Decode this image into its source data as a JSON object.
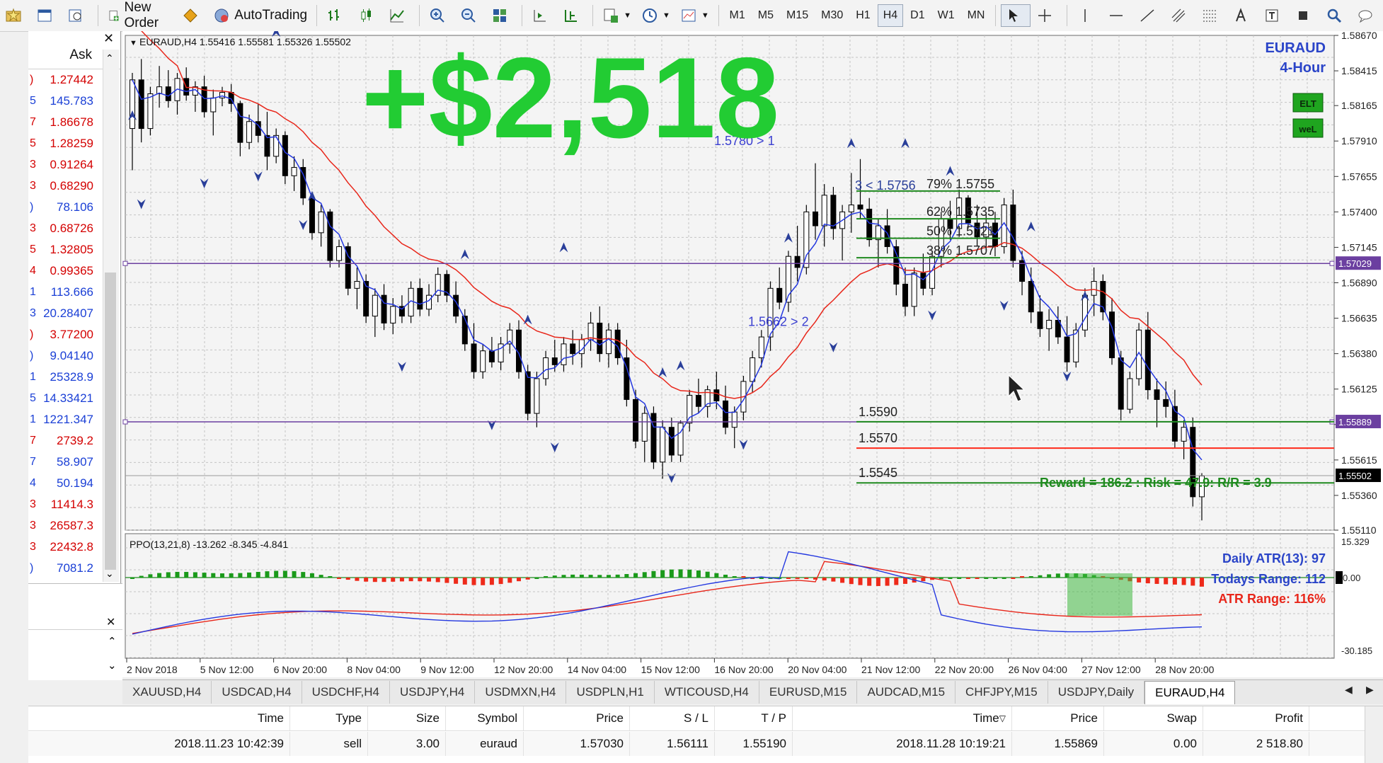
{
  "toolbar": {
    "new_order": "New Order",
    "autotrading": "AutoTrading",
    "timeframes": [
      "M1",
      "M5",
      "M15",
      "M30",
      "H1",
      "H4",
      "D1",
      "W1",
      "MN"
    ],
    "active_timeframe": "H4"
  },
  "market_watch": {
    "ask_header": "Ask",
    "rows": [
      {
        "stub": ")",
        "value": "1.27442",
        "color": "#d40000"
      },
      {
        "stub": "5",
        "value": "145.783",
        "color": "#1a3fd6"
      },
      {
        "stub": "7",
        "value": "1.86678",
        "color": "#d40000"
      },
      {
        "stub": "5",
        "value": "1.28259",
        "color": "#d40000"
      },
      {
        "stub": "3",
        "value": "0.91264",
        "color": "#d40000"
      },
      {
        "stub": "3",
        "value": "0.68290",
        "color": "#d40000"
      },
      {
        "stub": ")",
        "value": "78.106",
        "color": "#1a3fd6"
      },
      {
        "stub": "3",
        "value": "0.68726",
        "color": "#d40000"
      },
      {
        "stub": "5",
        "value": "1.32805",
        "color": "#d40000"
      },
      {
        "stub": "4",
        "value": "0.99365",
        "color": "#d40000"
      },
      {
        "stub": "1",
        "value": "113.666",
        "color": "#1a3fd6"
      },
      {
        "stub": "3",
        "value": "20.28407",
        "color": "#1a3fd6"
      },
      {
        "stub": ")",
        "value": "3.77200",
        "color": "#d40000"
      },
      {
        "stub": ")",
        "value": "9.04140",
        "color": "#1a3fd6"
      },
      {
        "stub": "1",
        "value": "25328.9",
        "color": "#1a3fd6"
      },
      {
        "stub": "5",
        "value": "14.33421",
        "color": "#1a3fd6"
      },
      {
        "stub": "1",
        "value": "1221.347",
        "color": "#1a3fd6"
      },
      {
        "stub": "7",
        "value": "2739.2",
        "color": "#d40000"
      },
      {
        "stub": "7",
        "value": "58.907",
        "color": "#1a3fd6"
      },
      {
        "stub": "4",
        "value": "50.194",
        "color": "#1a3fd6"
      },
      {
        "stub": "3",
        "value": "11414.3",
        "color": "#d40000"
      },
      {
        "stub": "3",
        "value": "26587.3",
        "color": "#d40000"
      },
      {
        "stub": "3",
        "value": "22432.8",
        "color": "#d40000"
      },
      {
        "stub": ")",
        "value": "7081.2",
        "color": "#1a3fd6"
      }
    ]
  },
  "chart": {
    "header": "EURAUD,H4  1.55416 1.55581 1.55326 1.55502",
    "profit_overlay": "+$2,518",
    "symbol_label": "EURAUD",
    "period_label": "4-Hour",
    "badges": [
      "ELT",
      "weL"
    ],
    "ppo_header": "PPO(13,21,8) -13.262 -8.345 -4.841",
    "fib_labels": [
      "79% 1.5755",
      "62% 1.5735",
      "50% 1.5721",
      "38% 1.5707"
    ],
    "fib_high": "3 < 1.5756",
    "swing_high": "1.5780 > 1",
    "swing_low": "1.5662 > 2",
    "level_entry": "1.5590",
    "level_stop": "1.5570",
    "level_target": "1.5545",
    "reward_risk": "Reward = 186.2 : Risk = 47.9: R/R = 3.9",
    "daily_atr": "Daily ATR(13): 97",
    "todays_range": "Todays Range: 112",
    "atr_range": "ATR Range: 116%",
    "price_ticks": [
      "1.58670",
      "1.58415",
      "1.58165",
      "1.57910",
      "1.57655",
      "1.57400",
      "1.57145",
      "1.56890",
      "1.56635",
      "1.56380",
      "1.56125",
      "1.55870",
      "1.55615",
      "1.55360",
      "1.55110"
    ],
    "price_marker_purple_top": "1.57029",
    "price_marker_purple_bottom": "1.55889",
    "price_marker_current": "1.55502",
    "ppo_ticks": [
      "15.329",
      "0.00",
      "-30.185"
    ],
    "time_ticks": [
      "2 Nov 2018",
      "5 Nov 12:00",
      "6 Nov 20:00",
      "8 Nov 04:00",
      "9 Nov 12:00",
      "12 Nov 20:00",
      "14 Nov 04:00",
      "15 Nov 12:00",
      "16 Nov 20:00",
      "20 Nov 04:00",
      "21 Nov 12:00",
      "22 Nov 20:00",
      "26 Nov 04:00",
      "27 Nov 12:00",
      "28 Nov 20:00"
    ]
  },
  "tabs": [
    "XAUUSD,H4",
    "USDCAD,H4",
    "USDCHF,H4",
    "USDJPY,H4",
    "USDMXN,H4",
    "USDPLN,H1",
    "WTICOUSD,H4",
    "EURUSD,M15",
    "AUDCAD,M15",
    "CHFJPY,M15",
    "USDJPY,Daily",
    "EURAUD,H4"
  ],
  "active_tab": "EURAUD,H4",
  "terminal": {
    "headers": [
      "Time",
      "Type",
      "Size",
      "Symbol",
      "Price",
      "S / L",
      "T / P",
      "Time",
      "Price",
      "Swap",
      "Profit"
    ],
    "row": [
      "2018.11.23 10:42:39",
      "sell",
      "3.00",
      "euraud",
      "1.57030",
      "1.56111",
      "1.55190",
      "2018.11.28 10:19:21",
      "1.55869",
      "0.00",
      "2 518.80"
    ]
  },
  "colors": {
    "bull": "#ffffff",
    "bear": "#000000",
    "profit_green": "#22cc33",
    "ma_red": "#e8261a",
    "ma_blue": "#2438e0",
    "fib_green": "#1f8a1f",
    "stop_red": "#ff2a1a",
    "purple": "#6b3fa0"
  }
}
